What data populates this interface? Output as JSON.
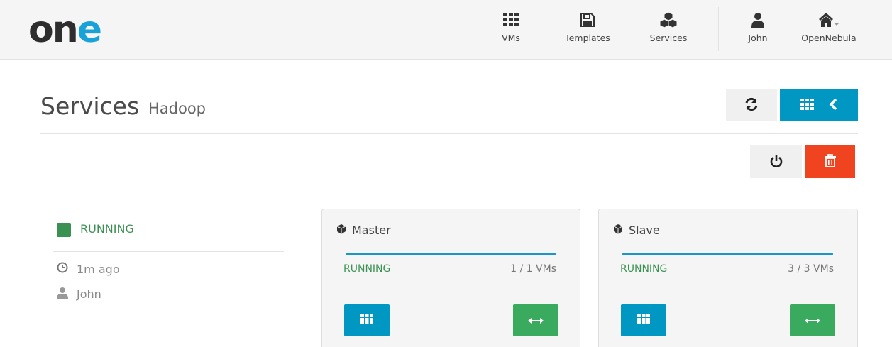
{
  "brand": {
    "logo_dark": "on",
    "logo_accent": "e"
  },
  "nav": [
    {
      "label": "VMs",
      "icon": "grid-icon"
    },
    {
      "label": "Templates",
      "icon": "floppy-icon"
    },
    {
      "label": "Services",
      "icon": "cubes-icon"
    },
    {
      "label": "John",
      "icon": "user-icon"
    },
    {
      "label": "OpenNebula",
      "icon": "home-icon"
    }
  ],
  "page": {
    "title": "Services",
    "subtitle": "Hadoop"
  },
  "service": {
    "state": "RUNNING",
    "time": "1m ago",
    "owner": "John"
  },
  "roles": [
    {
      "name": "Master",
      "state": "RUNNING",
      "vms": "1 / 1 VMs",
      "progress": 1.0
    },
    {
      "name": "Slave",
      "state": "RUNNING",
      "vms": "3 / 3 VMs",
      "progress": 1.0
    }
  ],
  "colors": {
    "accent": "#0098c3",
    "running": "#3b9152",
    "danger": "#f0431f",
    "scale": "#3aaa5e"
  }
}
